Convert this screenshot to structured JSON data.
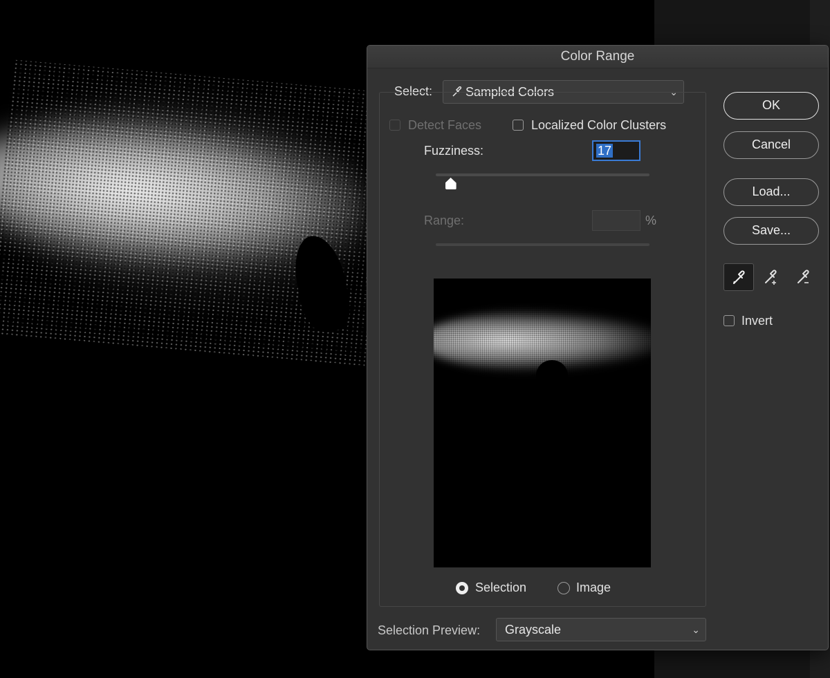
{
  "dialog": {
    "title": "Color Range",
    "select_label": "Select:",
    "select_value": "Sampled Colors",
    "select_icon": "eyedropper-icon",
    "detect_faces_label": "Detect Faces",
    "detect_faces_checked": false,
    "detect_faces_enabled": false,
    "localized_label": "Localized Color Clusters",
    "localized_checked": false,
    "fuzziness_label": "Fuzziness:",
    "fuzziness_value": "17",
    "fuzziness_slider_fraction": 0.07,
    "range_label": "Range:",
    "range_value": "",
    "range_unit": "%",
    "preview_mode_options": [
      {
        "label": "Selection",
        "selected": true
      },
      {
        "label": "Image",
        "selected": false
      }
    ],
    "selection_preview_label": "Selection Preview:",
    "selection_preview_value": "Grayscale",
    "buttons": {
      "ok": "OK",
      "cancel": "Cancel",
      "load": "Load...",
      "save": "Save..."
    },
    "tools": [
      "eyedropper-icon",
      "eyedropper-add-icon",
      "eyedropper-subtract-icon"
    ],
    "invert_label": "Invert",
    "invert_checked": false
  },
  "colors": {
    "dialog_bg": "#323232",
    "focus_ring": "#3a7bd5"
  }
}
